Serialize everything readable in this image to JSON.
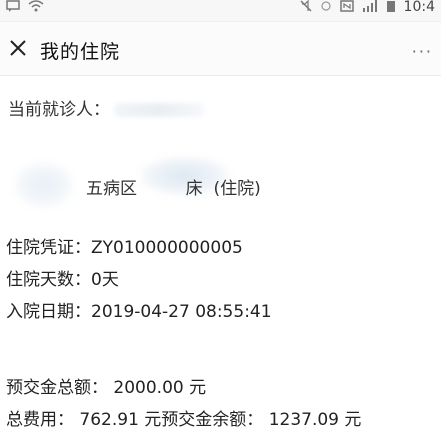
{
  "statusbar": {
    "left_icons": [
      "message-icon",
      "wifi-icon"
    ],
    "right_icons": [
      "mute-icon",
      "alarm-icon",
      "nfc-icon",
      "signal-icon",
      "battery-icon"
    ],
    "time": "10:4"
  },
  "nav": {
    "title": "我的住院",
    "close_glyph": "✕",
    "more_glyph": "···"
  },
  "patient": {
    "label": "当前就诊人："
  },
  "ward": {
    "text": "五病区         床  (住院)"
  },
  "admission": {
    "voucher_label": "住院凭证：",
    "voucher_value": "ZY010000000005",
    "days_label": "住院天数：",
    "days_value": "0天",
    "date_label": "入院日期：",
    "date_value": "2019-04-27 08:55:41"
  },
  "fees": {
    "prepay_label": "预交金总额：",
    "prepay_value": " 2000.00 元",
    "total_label": "总费用：",
    "total_value": " 762.91 元",
    "balance_label": "预交金余额：",
    "balance_value": " 1237.09 元"
  }
}
